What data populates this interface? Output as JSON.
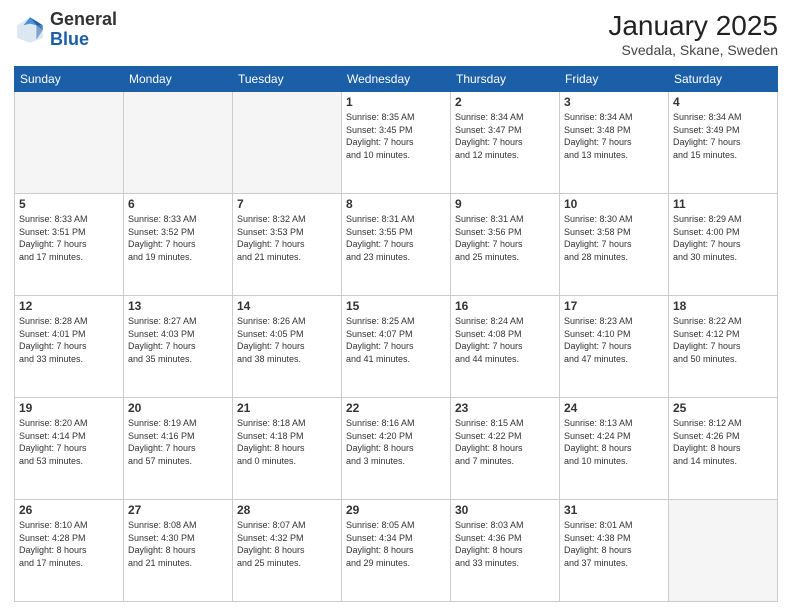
{
  "header": {
    "logo_general": "General",
    "logo_blue": "Blue",
    "month_year": "January 2025",
    "location": "Svedala, Skane, Sweden"
  },
  "days_of_week": [
    "Sunday",
    "Monday",
    "Tuesday",
    "Wednesday",
    "Thursday",
    "Friday",
    "Saturday"
  ],
  "weeks": [
    [
      {
        "day": "",
        "info": ""
      },
      {
        "day": "",
        "info": ""
      },
      {
        "day": "",
        "info": ""
      },
      {
        "day": "1",
        "info": "Sunrise: 8:35 AM\nSunset: 3:45 PM\nDaylight: 7 hours\nand 10 minutes."
      },
      {
        "day": "2",
        "info": "Sunrise: 8:34 AM\nSunset: 3:47 PM\nDaylight: 7 hours\nand 12 minutes."
      },
      {
        "day": "3",
        "info": "Sunrise: 8:34 AM\nSunset: 3:48 PM\nDaylight: 7 hours\nand 13 minutes."
      },
      {
        "day": "4",
        "info": "Sunrise: 8:34 AM\nSunset: 3:49 PM\nDaylight: 7 hours\nand 15 minutes."
      }
    ],
    [
      {
        "day": "5",
        "info": "Sunrise: 8:33 AM\nSunset: 3:51 PM\nDaylight: 7 hours\nand 17 minutes."
      },
      {
        "day": "6",
        "info": "Sunrise: 8:33 AM\nSunset: 3:52 PM\nDaylight: 7 hours\nand 19 minutes."
      },
      {
        "day": "7",
        "info": "Sunrise: 8:32 AM\nSunset: 3:53 PM\nDaylight: 7 hours\nand 21 minutes."
      },
      {
        "day": "8",
        "info": "Sunrise: 8:31 AM\nSunset: 3:55 PM\nDaylight: 7 hours\nand 23 minutes."
      },
      {
        "day": "9",
        "info": "Sunrise: 8:31 AM\nSunset: 3:56 PM\nDaylight: 7 hours\nand 25 minutes."
      },
      {
        "day": "10",
        "info": "Sunrise: 8:30 AM\nSunset: 3:58 PM\nDaylight: 7 hours\nand 28 minutes."
      },
      {
        "day": "11",
        "info": "Sunrise: 8:29 AM\nSunset: 4:00 PM\nDaylight: 7 hours\nand 30 minutes."
      }
    ],
    [
      {
        "day": "12",
        "info": "Sunrise: 8:28 AM\nSunset: 4:01 PM\nDaylight: 7 hours\nand 33 minutes."
      },
      {
        "day": "13",
        "info": "Sunrise: 8:27 AM\nSunset: 4:03 PM\nDaylight: 7 hours\nand 35 minutes."
      },
      {
        "day": "14",
        "info": "Sunrise: 8:26 AM\nSunset: 4:05 PM\nDaylight: 7 hours\nand 38 minutes."
      },
      {
        "day": "15",
        "info": "Sunrise: 8:25 AM\nSunset: 4:07 PM\nDaylight: 7 hours\nand 41 minutes."
      },
      {
        "day": "16",
        "info": "Sunrise: 8:24 AM\nSunset: 4:08 PM\nDaylight: 7 hours\nand 44 minutes."
      },
      {
        "day": "17",
        "info": "Sunrise: 8:23 AM\nSunset: 4:10 PM\nDaylight: 7 hours\nand 47 minutes."
      },
      {
        "day": "18",
        "info": "Sunrise: 8:22 AM\nSunset: 4:12 PM\nDaylight: 7 hours\nand 50 minutes."
      }
    ],
    [
      {
        "day": "19",
        "info": "Sunrise: 8:20 AM\nSunset: 4:14 PM\nDaylight: 7 hours\nand 53 minutes."
      },
      {
        "day": "20",
        "info": "Sunrise: 8:19 AM\nSunset: 4:16 PM\nDaylight: 7 hours\nand 57 minutes."
      },
      {
        "day": "21",
        "info": "Sunrise: 8:18 AM\nSunset: 4:18 PM\nDaylight: 8 hours\nand 0 minutes."
      },
      {
        "day": "22",
        "info": "Sunrise: 8:16 AM\nSunset: 4:20 PM\nDaylight: 8 hours\nand 3 minutes."
      },
      {
        "day": "23",
        "info": "Sunrise: 8:15 AM\nSunset: 4:22 PM\nDaylight: 8 hours\nand 7 minutes."
      },
      {
        "day": "24",
        "info": "Sunrise: 8:13 AM\nSunset: 4:24 PM\nDaylight: 8 hours\nand 10 minutes."
      },
      {
        "day": "25",
        "info": "Sunrise: 8:12 AM\nSunset: 4:26 PM\nDaylight: 8 hours\nand 14 minutes."
      }
    ],
    [
      {
        "day": "26",
        "info": "Sunrise: 8:10 AM\nSunset: 4:28 PM\nDaylight: 8 hours\nand 17 minutes."
      },
      {
        "day": "27",
        "info": "Sunrise: 8:08 AM\nSunset: 4:30 PM\nDaylight: 8 hours\nand 21 minutes."
      },
      {
        "day": "28",
        "info": "Sunrise: 8:07 AM\nSunset: 4:32 PM\nDaylight: 8 hours\nand 25 minutes."
      },
      {
        "day": "29",
        "info": "Sunrise: 8:05 AM\nSunset: 4:34 PM\nDaylight: 8 hours\nand 29 minutes."
      },
      {
        "day": "30",
        "info": "Sunrise: 8:03 AM\nSunset: 4:36 PM\nDaylight: 8 hours\nand 33 minutes."
      },
      {
        "day": "31",
        "info": "Sunrise: 8:01 AM\nSunset: 4:38 PM\nDaylight: 8 hours\nand 37 minutes."
      },
      {
        "day": "",
        "info": ""
      }
    ]
  ]
}
